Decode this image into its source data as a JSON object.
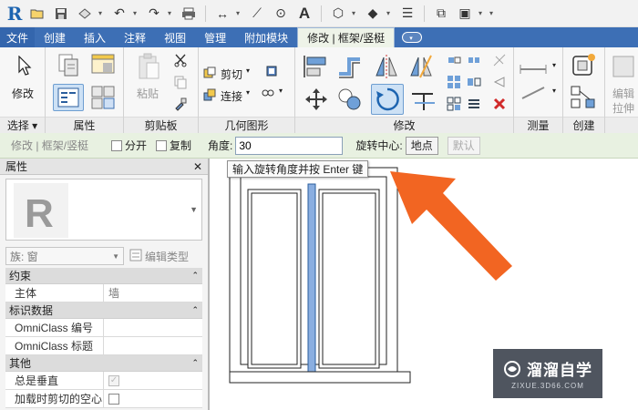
{
  "qat": {
    "icons": [
      "revit-logo-icon",
      "open-icon",
      "save-icon",
      "sync-icon",
      "undo-icon",
      "redo-icon",
      "print-icon",
      "measure-icon",
      "dimension-icon",
      "tag-icon",
      "text-icon",
      "3d-view-icon",
      "section-icon",
      "thin-lines-icon",
      "close-windows-icon",
      "switch-windows-icon",
      "customize-icon"
    ],
    "logo": "R",
    "text_tool": "A"
  },
  "tabs": {
    "items": [
      "文件",
      "创建",
      "插入",
      "注释",
      "视图",
      "管理",
      "附加模块",
      "修改 | 框架/竖梃"
    ],
    "active": "修改 | 框架/竖梃"
  },
  "ribbon": {
    "select": {
      "modify_label": "修改",
      "title": "选择 ▾"
    },
    "properties": {
      "title": "属性"
    },
    "clipboard": {
      "paste_label": "粘贴",
      "title": "剪贴板"
    },
    "geometry": {
      "cut_label": "剪切",
      "join_label": "连接",
      "title": "几何图形"
    },
    "modify": {
      "title": "修改"
    },
    "measure": {
      "title": "测量"
    },
    "create": {
      "title": "创建"
    },
    "edit": {
      "label": "编辑",
      "sub": "拉伸"
    }
  },
  "options": {
    "context": "修改 | 框架/竖梃",
    "split_label": "分开",
    "copy_label": "复制",
    "angle_label": "角度:",
    "angle_value": "30",
    "center_label": "旋转中心:",
    "place_button": "地点",
    "default_button": "默认"
  },
  "tooltip": {
    "text": "输入旋转角度并按 Enter 键"
  },
  "properties": {
    "title": "属性",
    "close": "✕",
    "family_label": "族: 窗",
    "edit_type_label": "编辑类型",
    "groups": [
      {
        "name": "约束",
        "rows": [
          {
            "key": "主体",
            "value": "墙"
          }
        ]
      },
      {
        "name": "标识数据",
        "rows": [
          {
            "key": "OmniClass 编号",
            "value": ""
          },
          {
            "key": "OmniClass 标题",
            "value": ""
          }
        ]
      },
      {
        "name": "其他",
        "rows": [
          {
            "key": "总是垂直",
            "value": ""
          },
          {
            "key": "加载时剪切的空心",
            "value": ""
          }
        ]
      }
    ]
  },
  "watermark": {
    "name": "溜溜自学",
    "site": "ZIXUE.3D66.COM"
  },
  "colors": {
    "tab_bar": "#3d6fb5",
    "options_bar": "#e8f1e1",
    "mullion_fill": "#8aaee0",
    "arrow": "#f26522"
  }
}
